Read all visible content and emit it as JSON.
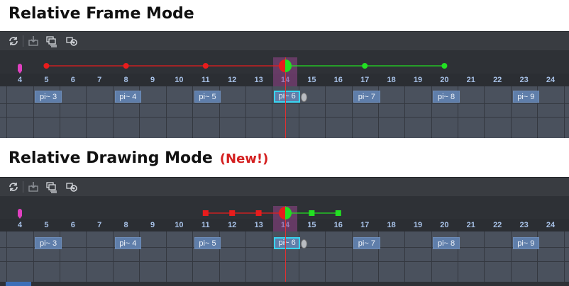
{
  "headings": {
    "frame": "Relative Frame Mode",
    "drawing": "Relative Drawing Mode",
    "new_badge": "(New!)"
  },
  "toolbar": {
    "buttons": [
      "loop-icon",
      "import-icon",
      "onion-skin-icon",
      "onion-settings-icon"
    ]
  },
  "ruler": {
    "frames": [
      "4",
      "5",
      "6",
      "7",
      "8",
      "9",
      "10",
      "11",
      "12",
      "13",
      "14",
      "15",
      "16",
      "17",
      "18",
      "19",
      "20",
      "21",
      "22",
      "23",
      "24"
    ]
  },
  "current_frame": "14",
  "cels": [
    "pi~ 3",
    "pi~ 4",
    "pi~ 5",
    "pi~ 6",
    "pi~ 7",
    "pi~ 8",
    "pi~ 9"
  ],
  "cel_start_frames": [
    5,
    8,
    11,
    14,
    17,
    20,
    23
  ],
  "frame_mode": {
    "previous_frames": [
      5,
      8,
      11
    ],
    "next_frames": [
      17,
      20
    ]
  },
  "drawing_mode": {
    "previous_frames": [
      11,
      12,
      13
    ],
    "next_frames": [
      15,
      16
    ]
  },
  "colors": {
    "previous": "#e81c1c",
    "next": "#22e022",
    "current_highlight": "#96468c",
    "playhead": "#e03030",
    "cel": "#5f7eaa",
    "selected_cel_border": "#38d4f0",
    "new_badge": "#d42020"
  }
}
